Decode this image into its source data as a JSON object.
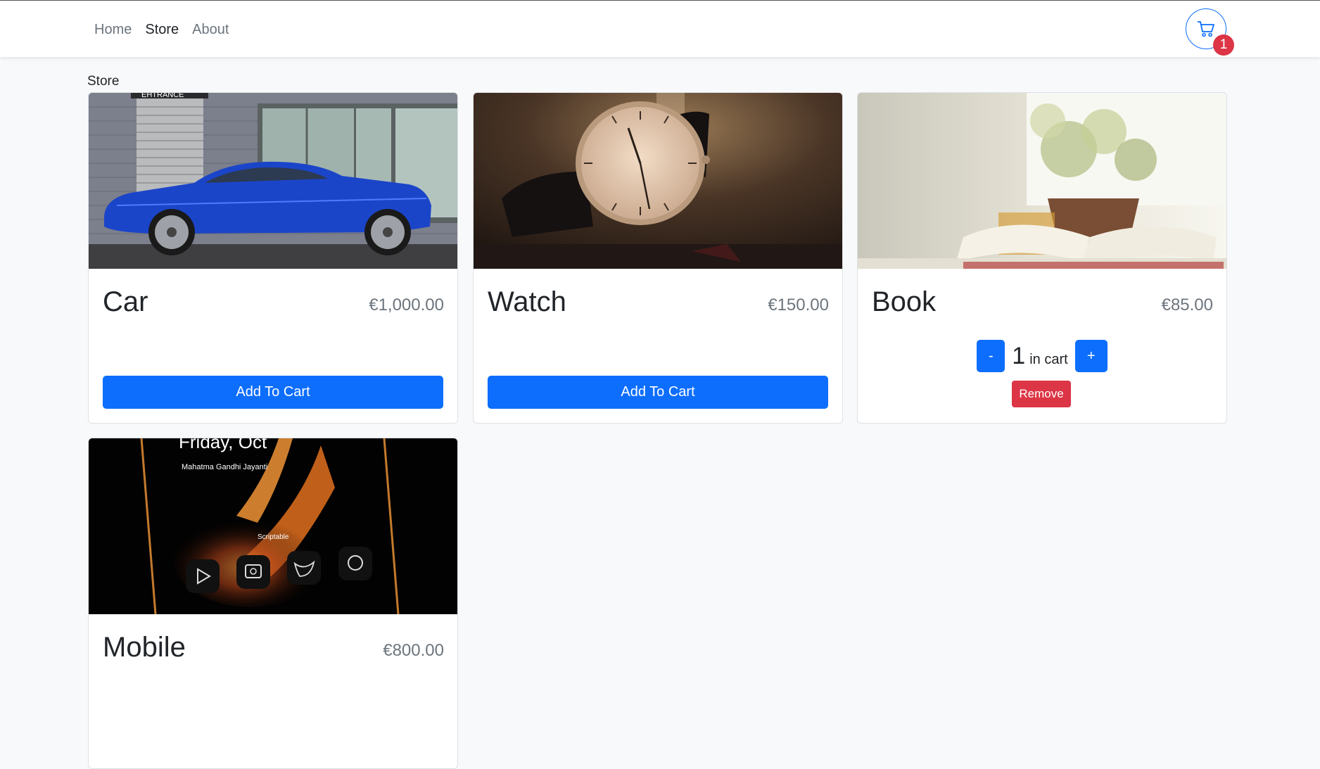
{
  "nav": {
    "links": [
      {
        "label": "Home",
        "active": false
      },
      {
        "label": "Store",
        "active": true
      },
      {
        "label": "About",
        "active": false
      }
    ],
    "cart_count": "1"
  },
  "page": {
    "heading": "Store"
  },
  "products": [
    {
      "name": "Car",
      "price": "€1,000.00",
      "button": "Add To Cart"
    },
    {
      "name": "Watch",
      "price": "€150.00",
      "button": "Add To Cart"
    },
    {
      "name": "Book",
      "price": "€85.00",
      "quantity": "1",
      "in_cart_label": "in cart",
      "minus_label": "-",
      "plus_label": "+",
      "remove_label": "Remove"
    },
    {
      "name": "Mobile",
      "price": "€800.00"
    }
  ],
  "image_text": {
    "mobile_line1": "Friday, Oct",
    "mobile_line2": "Mahatma Gandhi Jayanti",
    "mobile_line3": "Scriptable",
    "car_sign": "EHTRANCE"
  },
  "colors": {
    "primary": "#0d6efd",
    "danger": "#dc3545",
    "muted": "#6c757d"
  }
}
